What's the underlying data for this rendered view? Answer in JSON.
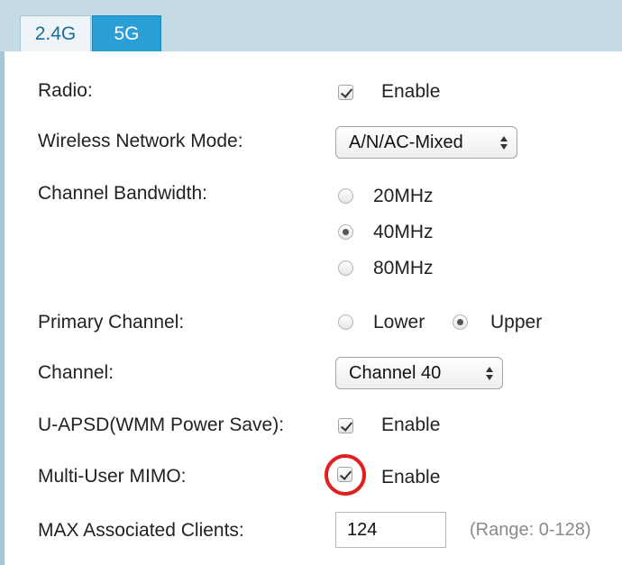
{
  "tabs": [
    {
      "label": "2.4G",
      "active": false
    },
    {
      "label": "5G",
      "active": true
    }
  ],
  "settings": {
    "radio": {
      "label": "Radio:",
      "checked": true,
      "option_label": "Enable"
    },
    "wireless_mode": {
      "label": "Wireless Network Mode:",
      "value": "A/N/AC-Mixed"
    },
    "channel_bandwidth": {
      "label": "Channel Bandwidth:",
      "options": [
        {
          "label": "20MHz",
          "selected": false
        },
        {
          "label": "40MHz",
          "selected": true
        },
        {
          "label": "80MHz",
          "selected": false
        }
      ]
    },
    "primary_channel": {
      "label": "Primary Channel:",
      "options": [
        {
          "label": "Lower",
          "selected": false
        },
        {
          "label": "Upper",
          "selected": true
        }
      ]
    },
    "channel": {
      "label": "Channel:",
      "value": "Channel 40"
    },
    "uapsd": {
      "label": "U-APSD(WMM Power Save):",
      "checked": true,
      "option_label": "Enable"
    },
    "mu_mimo": {
      "label": "Multi-User MIMO:",
      "checked": true,
      "option_label": "Enable",
      "highlighted": true
    },
    "max_clients": {
      "label": "MAX Associated Clients:",
      "value": "124",
      "hint": "(Range: 0-128)"
    }
  },
  "colors": {
    "tab_bar": "#c5dbe6",
    "active_tab": "#2a9fd6",
    "highlight_ring": "#e02020"
  },
  "icons": {
    "select_arrows": "updown-arrows-icon",
    "checkbox": "checkmark-icon"
  }
}
